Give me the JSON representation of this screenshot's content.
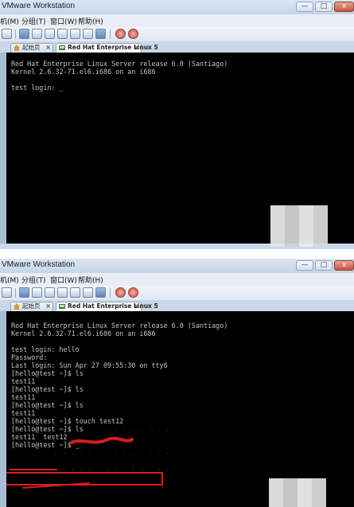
{
  "app": {
    "window_title": "VMware Workstation",
    "window_controls": {
      "minimize": "—",
      "restore": "□",
      "close": "x"
    }
  },
  "menu": [
    "机(M)",
    "分组(T)",
    "窗口(W)",
    "帮助(H)"
  ],
  "tabs": [
    {
      "label": "起始页",
      "active": false
    },
    {
      "label": "Red Hat Enterprise Linux 5",
      "active": true
    }
  ],
  "screens": [
    {
      "lines": [
        {
          "text": "Red Hat Enterprise Linux Server release 6.0 (Santiago)",
          "color": "default"
        },
        {
          "text": "Kernel 2.6.32-71.el6.i686 on an i686",
          "color": "default"
        },
        {
          "text": "",
          "color": "default"
        },
        {
          "text": "test login: _",
          "color": "default"
        }
      ]
    },
    {
      "lines": [
        {
          "text": "Red Hat Enterprise Linux Server release 6.0 (Santiago)",
          "color": "default"
        },
        {
          "text": "Kernel 2.6.32-71.el6.i686 on an i686",
          "color": "default"
        },
        {
          "text": "",
          "color": "default"
        },
        {
          "text": "test login: hello",
          "color": "default"
        },
        {
          "text": "Password:",
          "color": "default"
        },
        {
          "text": "Last login: Sun Apr 27 09:55:30 on tty6",
          "color": "default"
        },
        {
          "text": "[hello@test ~]$ ls",
          "color": "default"
        },
        {
          "text": "test11",
          "color": "default"
        },
        {
          "text": "[hello@test ~]$ ls",
          "color": "default"
        },
        {
          "text": "test11",
          "color": "default"
        },
        {
          "text": "[hello@test ~]$ ls",
          "color": "default"
        },
        {
          "text": "test11",
          "color": "default"
        },
        {
          "text": "[hello@test ~]$ touch test12",
          "color": "default"
        },
        {
          "text": "[hello@test ~]$ ls",
          "color": "default"
        },
        {
          "text": "test11  test12",
          "color": "default"
        },
        {
          "text": "[hello@test ~]$ _",
          "color": "default"
        }
      ]
    }
  ],
  "colors": {
    "console_bg": "#000000",
    "console_fg": "#c4c4c4",
    "annotation_red": "#d81c1c",
    "chrome_blue": "#c9d7e8"
  }
}
